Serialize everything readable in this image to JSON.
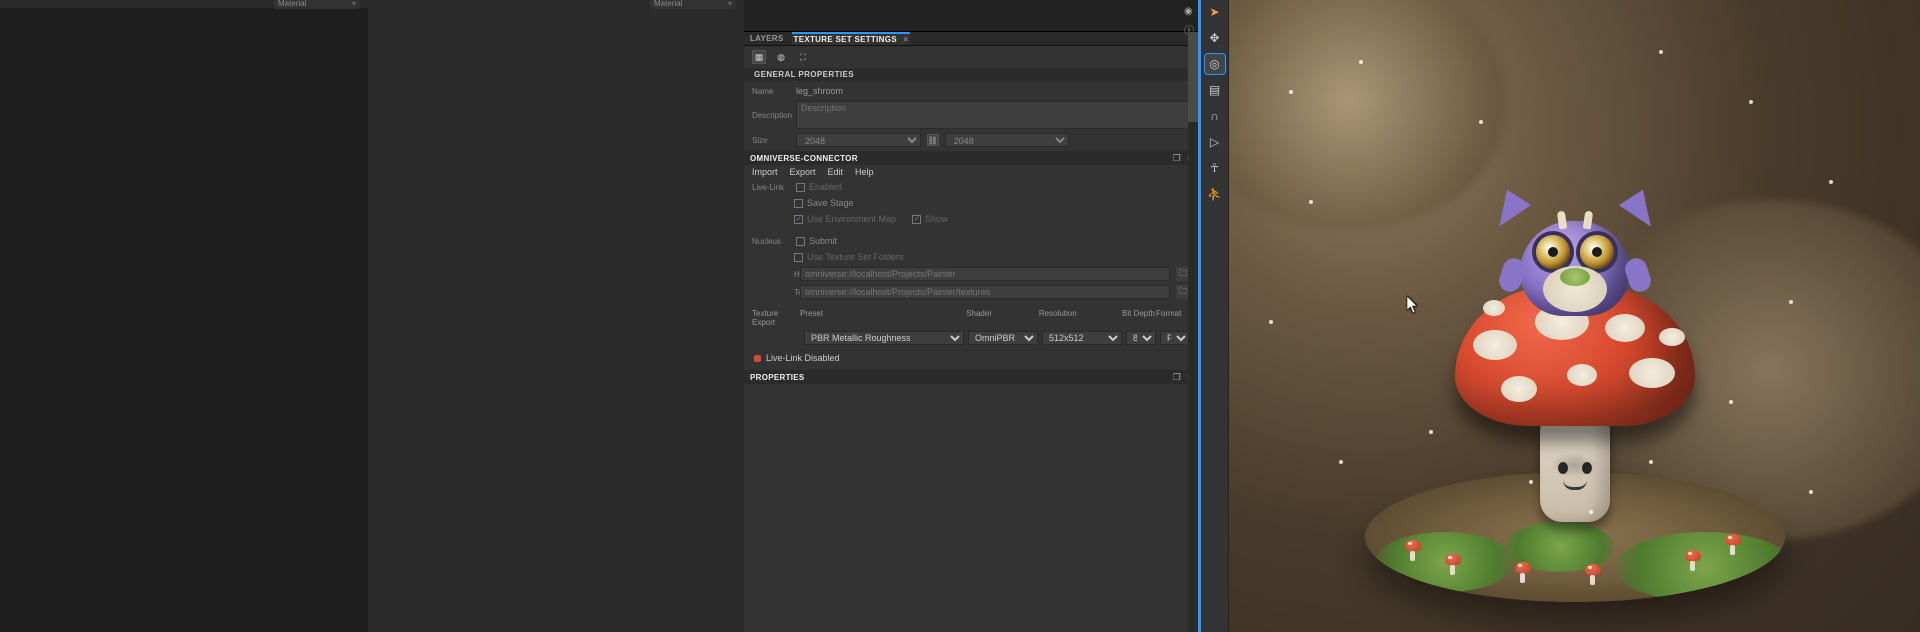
{
  "left": {
    "dd1": "Material",
    "dd2": "Material"
  },
  "tabs": {
    "layers": "LAYERS",
    "tss": "TEXTURE SET SETTINGS"
  },
  "general": {
    "title": "GENERAL PROPERTIES",
    "name_lbl": "Name",
    "name_val": "leg_shroom",
    "desc_lbl": "Description",
    "desc_ph": "Description",
    "size_lbl": "Size",
    "size_w": "2048",
    "size_h": "2048"
  },
  "omni": {
    "title": "OMNIVERSE-CONNECTOR",
    "menu": {
      "import": "Import",
      "export": "Export",
      "edit": "Edit",
      "help": "Help"
    },
    "livelink_lbl": "Live-Link",
    "chk_enabled": "Enabled",
    "chk_savestage": "Save Stage",
    "chk_envmap": "Use Environment Map",
    "chk_show": "Show",
    "nucleus_lbl": "Nucleus",
    "chk_submit": "Submit",
    "chk_usefolders": "Use Texture Set Folders",
    "host_lbl": "Host",
    "host_val": "omniverse://localhost/Projects/Painter",
    "tex_lbl": "Textures",
    "tex_val": "omniverse://localhost/Projects/Painter/textures",
    "texexport_lbl": "Texture Export",
    "head": {
      "preset": "Preset",
      "shader": "Shader",
      "res": "Resolution",
      "bit": "Bit Depth",
      "fmt": "Format"
    },
    "preset_val": "PBR Metallic Roughness",
    "shader_val": "OmniPBR",
    "res_val": "512x512",
    "bit_val": "8",
    "fmt_val": "PNG",
    "status": "Live-Link Disabled"
  },
  "properties": {
    "title": "PROPERTIES"
  },
  "colors": {
    "accent": "#2998ff"
  }
}
